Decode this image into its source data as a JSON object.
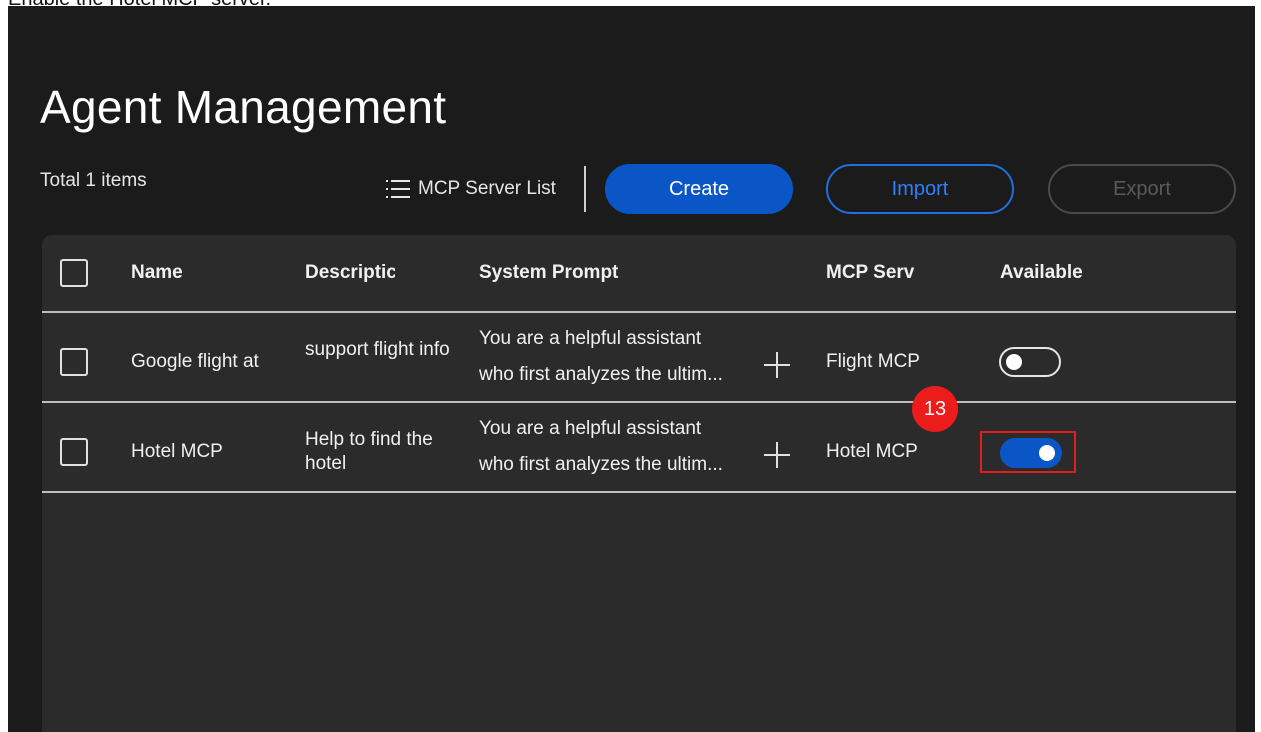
{
  "instruction": "Enable the Hotel MCP server.",
  "page": {
    "title": "Agent Management",
    "total_items": "Total 1 items"
  },
  "toolbar": {
    "mcp_server_list_label": "MCP Server List",
    "create_label": "Create",
    "import_label": "Import",
    "export_label": "Export",
    "list_icon": "list-icon"
  },
  "table": {
    "columns": [
      "Name",
      "Descriptic",
      "System Prompt",
      "MCP Serv",
      "Available"
    ],
    "rows": [
      {
        "name": "Google flight at",
        "description": "support flight info",
        "system_prompt_line1": "You are a helpful assistant",
        "system_prompt_line2": "who first analyzes the ultim...",
        "mcp_server": "Flight MCP",
        "available": false
      },
      {
        "name": "Hotel MCP",
        "description": "Help to find the hotel",
        "system_prompt_line1": "You are a helpful assistant",
        "system_prompt_line2": "who first analyzes the ultim...",
        "mcp_server": "Hotel MCP",
        "available": true
      }
    ]
  },
  "annotation": {
    "step_number": "13",
    "badge_color": "#ec1c1c",
    "highlight_color": "#e21d1d"
  },
  "colors": {
    "primary": "#0a56c7",
    "background": "#1b1b1b",
    "panel": "#2b2b2b"
  }
}
